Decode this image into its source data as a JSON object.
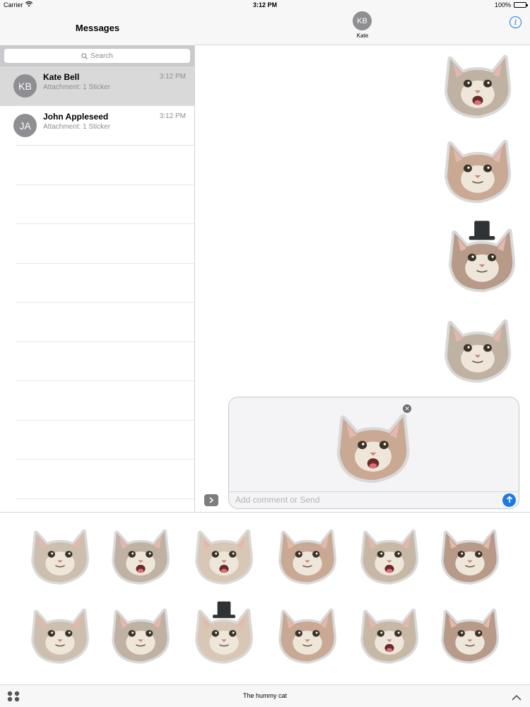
{
  "status_bar": {
    "carrier": "Carrier",
    "time": "3:12 PM",
    "battery": "100%",
    "battery_level": 1.0
  },
  "sidebar": {
    "title": "Messages",
    "search_placeholder": "Search",
    "conversations": [
      {
        "initials": "KB",
        "name": "Kate Bell",
        "preview": "Attachment: 1 Sticker",
        "time": "3:12 PM",
        "selected": true
      },
      {
        "initials": "JA",
        "name": "John Appleseed",
        "preview": "Attachment: 1 Sticker",
        "time": "3:12 PM",
        "selected": false
      }
    ]
  },
  "chat": {
    "contact_initials": "KB",
    "contact_name": "Kate",
    "info_icon": "info-icon",
    "sent_stickers": [
      "cat-sticker-screaming",
      "cat-sticker-surprised",
      "cat-sticker-top-hat",
      "cat-sticker-winking"
    ],
    "compose": {
      "placeholder": "Add comment or Send",
      "staged_sticker": "cat-sticker-tongue-out",
      "remove_icon": "close-icon",
      "send_icon": "arrow-up-icon"
    }
  },
  "sticker_drawer": {
    "title": "The hummy cat",
    "stickers": [
      "cat-sticker-surprised",
      "cat-sticker-tongue-out",
      "cat-sticker-grinning",
      "cat-sticker-pouting",
      "cat-sticker-screaming",
      "cat-sticker-sad",
      "cat-sticker-lounging",
      "cat-sticker-smiling",
      "cat-sticker-top-hat",
      "cat-sticker-dazed",
      "cat-sticker-laughing",
      "cat-sticker-blank-stare"
    ]
  },
  "colors": {
    "accent": "#1f7ae0",
    "avatar": "#8e8e93",
    "selected_row": "#d9d9d9"
  }
}
